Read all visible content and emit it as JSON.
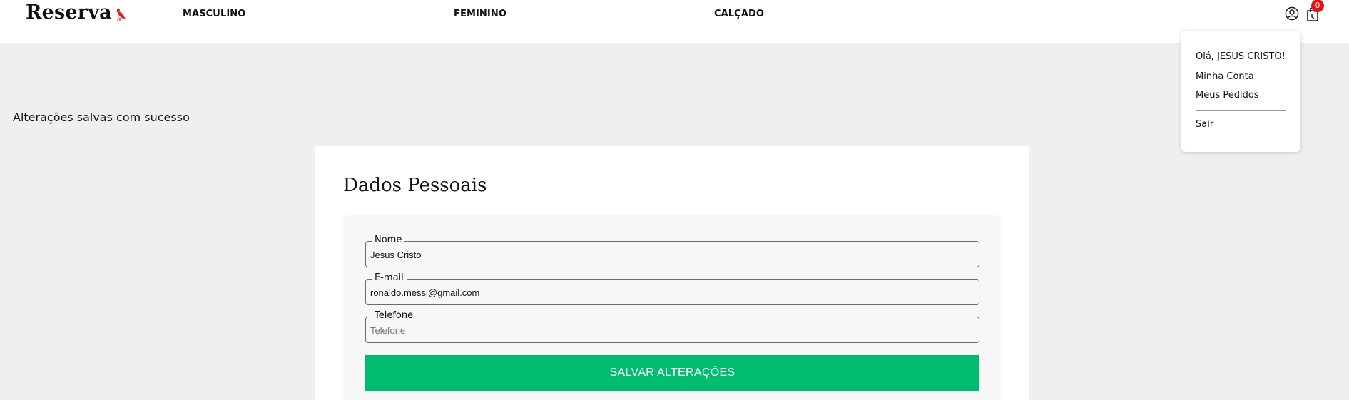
{
  "header": {
    "logo_text": "Reserva",
    "nav": [
      {
        "label": "MASCULINO"
      },
      {
        "label": "FEMININO"
      },
      {
        "label": "CALÇADO"
      }
    ],
    "cart_count": "0",
    "icons": {
      "user": "user-icon",
      "cart": "shopping-bag-icon",
      "logo_mark": "bird-icon"
    }
  },
  "user_menu": {
    "greeting": "Olá, JESUS CRISTO!",
    "items": [
      {
        "label": "Minha Conta"
      },
      {
        "label": "Meus Pedidos"
      }
    ],
    "logout": "Sair"
  },
  "status": {
    "message": "Alterações salvas com sucesso"
  },
  "form": {
    "title": "Dados Pessoais",
    "fields": [
      {
        "label": "Nome",
        "value": "Jesus Cristo",
        "placeholder": ""
      },
      {
        "label": "E-mail",
        "value": "ronaldo.messi@gmail.com",
        "placeholder": ""
      },
      {
        "label": "Telefone",
        "value": "",
        "placeholder": "Telefone"
      }
    ],
    "submit_label": "SALVAR ALTERAÇÕES"
  },
  "colors": {
    "accent_green": "#00bc6e",
    "badge_red": "#e41212",
    "brand_red": "#d8262e",
    "background": "#efefef"
  }
}
